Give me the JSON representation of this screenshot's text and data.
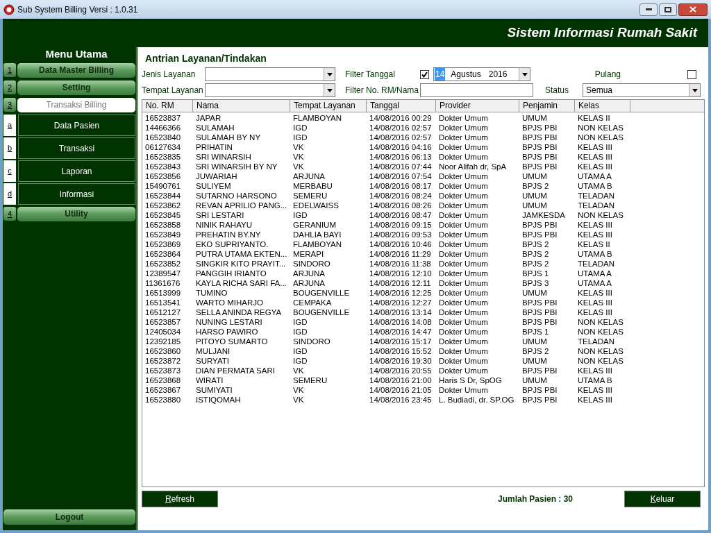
{
  "window": {
    "title": "Sub System Billing Versi : 1.0.31"
  },
  "header": {
    "title": "Sistem Informasi Rumah Sakit"
  },
  "sidebar": {
    "title": "Menu Utama",
    "items": [
      {
        "key": "1",
        "label": "Data Master Billing",
        "kind": "main",
        "selected": false
      },
      {
        "key": "2",
        "label": "Setting",
        "kind": "main",
        "selected": false
      },
      {
        "key": "3",
        "label": "Transaksi Billing",
        "kind": "main",
        "selected": true
      },
      {
        "key": "a",
        "label": "Data Pasien",
        "kind": "sub",
        "selected": false
      },
      {
        "key": "b",
        "label": "Transaksi",
        "kind": "sub",
        "selected": false
      },
      {
        "key": "c",
        "label": "Laporan",
        "kind": "sub",
        "selected": false
      },
      {
        "key": "d",
        "label": "Informasi",
        "kind": "sub",
        "selected": false
      },
      {
        "key": "4",
        "label": "Utility",
        "kind": "main",
        "selected": false
      }
    ],
    "logout": "Logout"
  },
  "content": {
    "title": "Antrian Layanan/Tindakan",
    "filters": {
      "jenis_layanan": {
        "label": "Jenis Layanan"
      },
      "tempat_layanan": {
        "label": "Tempat Layanan"
      },
      "filter_tanggal": {
        "label": "Filter Tanggal",
        "checked": true,
        "day": "14",
        "month": "Agustus",
        "year": "2016"
      },
      "pulang": {
        "label": "Pulang",
        "checked": false
      },
      "filter_rm": {
        "label": "Filter No. RM/Nama"
      },
      "status": {
        "label": "Status",
        "value": "Semua"
      }
    },
    "table": {
      "columns": [
        "No. RM",
        "Nama",
        "Tempat Layanan",
        "Tanggal",
        "Provider",
        "Penjamin",
        "Kelas"
      ],
      "rows": [
        [
          "16523837",
          "JAPAR",
          "FLAMBOYAN",
          "14/08/2016 00:29",
          "Dokter Umum",
          "UMUM",
          "KELAS II"
        ],
        [
          "14466366",
          "SULAMAH",
          "IGD",
          "14/08/2016 02:57",
          "Dokter Umum",
          "BPJS PBI",
          "NON KELAS"
        ],
        [
          "16523840",
          "SULAMAH BY NY",
          "IGD",
          "14/08/2016 02:57",
          "Dokter Umum",
          "BPJS PBI",
          "NON KELAS"
        ],
        [
          "06127634",
          "PRIHATIN",
          "VK",
          "14/08/2016 04:16",
          "Dokter Umum",
          "BPJS PBI",
          "KELAS III"
        ],
        [
          "16523835",
          "SRI WINARSIH",
          "VK",
          "14/08/2016 06:13",
          "Dokter Umum",
          "BPJS PBI",
          "KELAS III"
        ],
        [
          "16523843",
          "SRI WINARSIH BY NY",
          "VK",
          "14/08/2016 07:44",
          "Noor Alifah dr, SpA",
          "BPJS PBI",
          "KELAS III"
        ],
        [
          "16523856",
          "JUWARIAH",
          "ARJUNA",
          "14/08/2016 07:54",
          "Dokter Umum",
          "UMUM",
          "UTAMA A"
        ],
        [
          "15490761",
          "SULIYEM",
          "MERBABU",
          "14/08/2016 08:17",
          "Dokter Umum",
          "BPJS 2",
          "UTAMA B"
        ],
        [
          "16523844",
          "SUTARNO HARSONO",
          "SEMERU",
          "14/08/2016 08:24",
          "Dokter Umum",
          "UMUM",
          "TELADAN"
        ],
        [
          "16523862",
          "REVAN APRILIO PANG...",
          "EDELWAISS",
          "14/08/2016 08:26",
          "Dokter Umum",
          "UMUM",
          "TELADAN"
        ],
        [
          "16523845",
          "SRI LESTARI",
          "IGD",
          "14/08/2016 08:47",
          "Dokter Umum",
          "JAMKESDA",
          "NON KELAS"
        ],
        [
          "16523858",
          "NINIK RAHAYU",
          "GERANIUM",
          "14/08/2016 09:15",
          "Dokter Umum",
          "BPJS PBI",
          "KELAS III"
        ],
        [
          "16523849",
          "PREHATIN BY.NY",
          "DAHLIA BAYI",
          "14/08/2016 09:53",
          "Dokter Umum",
          "BPJS PBI",
          "KELAS III"
        ],
        [
          "16523869",
          "EKO SUPRIYANTO.",
          "FLAMBOYAN",
          "14/08/2016 10:46",
          "Dokter Umum",
          "BPJS 2",
          "KELAS II"
        ],
        [
          "16523864",
          "PUTRA UTAMA EKTEN...",
          "MERAPI",
          "14/08/2016 11:29",
          "Dokter Umum",
          "BPJS 2",
          "UTAMA B"
        ],
        [
          "16523852",
          "SINGKIR KITO PRAYIT...",
          "SINDORO",
          "14/08/2016 11:38",
          "Dokter Umum",
          "BPJS 2",
          "TELADAN"
        ],
        [
          "12389547",
          "PANGGIH IRIANTO",
          "ARJUNA",
          "14/08/2016 12:10",
          "Dokter Umum",
          "BPJS 1",
          "UTAMA A"
        ],
        [
          "11361676",
          "KAYLA RICHA SARI FA...",
          "ARJUNA",
          "14/08/2016 12:11",
          "Dokter Umum",
          "BPJS 3",
          "UTAMA A"
        ],
        [
          "16513999",
          "TUMINO",
          "BOUGENVILLE",
          "14/08/2016 12:25",
          "Dokter Umum",
          "UMUM",
          "KELAS III"
        ],
        [
          "16513541",
          "WARTO MIHARJO",
          "CEMPAKA",
          "14/08/2016 12:27",
          "Dokter Umum",
          "BPJS PBI",
          "KELAS III"
        ],
        [
          "16512127",
          "SELLA ANINDA REGYA",
          "BOUGENVILLE",
          "14/08/2016 13:14",
          "Dokter Umum",
          "BPJS PBI",
          "KELAS III"
        ],
        [
          "16523857",
          "NUNING LESTARI",
          "IGD",
          "14/08/2016 14:08",
          "Dokter Umum",
          "BPJS PBI",
          "NON KELAS"
        ],
        [
          "12405034",
          "HARSO PAWIRO",
          "IGD",
          "14/08/2016 14:47",
          "Dokter Umum",
          "BPJS 1",
          "NON KELAS"
        ],
        [
          "12392185",
          "PITOYO SUMARTO",
          "SINDORO",
          "14/08/2016 15:17",
          "Dokter Umum",
          "UMUM",
          "TELADAN"
        ],
        [
          "16523860",
          "MULJANI",
          "IGD",
          "14/08/2016 15:52",
          "Dokter Umum",
          "BPJS 2",
          "NON KELAS"
        ],
        [
          "16523872",
          "SURYATI",
          "IGD",
          "14/08/2016 19:30",
          "Dokter Umum",
          "UMUM",
          "NON KELAS"
        ],
        [
          "16523873",
          "DIAN PERMATA SARI",
          "VK",
          "14/08/2016 20:55",
          "Dokter Umum",
          "BPJS PBI",
          "KELAS III"
        ],
        [
          "16523868",
          "WIRATI",
          "SEMERU",
          "14/08/2016 21:00",
          "Haris S Dr, SpOG",
          "UMUM",
          "UTAMA B"
        ],
        [
          "16523867",
          "SUMIYATI",
          "VK",
          "14/08/2016 21:05",
          "Dokter Umum",
          "BPJS PBI",
          "KELAS III"
        ],
        [
          "16523880",
          "ISTIQOMAH",
          "VK",
          "14/08/2016 23:45",
          "L. Budiadi, dr. SP.OG",
          "BPJS PBI",
          "KELAS III"
        ]
      ]
    },
    "refresh_button": "Refresh",
    "count": "Jumlah Pasien : 30",
    "exit_button": "Keluar"
  }
}
